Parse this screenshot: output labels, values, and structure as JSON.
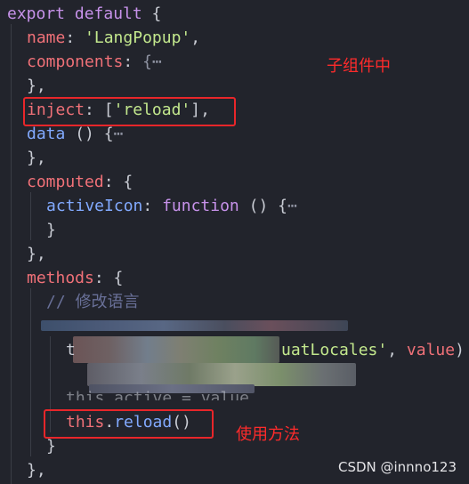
{
  "code": {
    "l1": {
      "kw": "export default",
      "brace": " {"
    },
    "l2": {
      "key": "name",
      "colon": ": ",
      "value": "'LangPopup'",
      "comma": ","
    },
    "l3": {
      "key": "components",
      "colon": ": ",
      "fold": "{⋯"
    },
    "l4": {
      "text": "},"
    },
    "l5": {
      "key": "inject",
      "colon": ": ",
      "open": "[",
      "value": "'reload'",
      "close": "],"
    },
    "l6": {
      "key": "data",
      "rest": " () {",
      "fold": "⋯"
    },
    "l7": {
      "text": "},"
    },
    "l8": {
      "key": "computed",
      "colon": ": ",
      "brace": "{"
    },
    "l9": {
      "key": "activeIcon",
      "colon": ": ",
      "kw": "function",
      "rest": " () {",
      "fold": "⋯"
    },
    "l10": {
      "text": "}"
    },
    "l11": {
      "text": "},"
    },
    "l12": {
      "key": "methods",
      "colon": ": ",
      "brace": "{"
    },
    "l13": {
      "comment": "// 修改语言"
    },
    "l15": {
      "lead": "t",
      "tail_str": "uatLocales'",
      "tail_sep": ", ",
      "tail_val": "value",
      "tail_end": ")"
    },
    "l17": {
      "partial": "this.active = value"
    },
    "l18": {
      "this": "this",
      "dot": ".",
      "method": "reload",
      "parens": "()"
    },
    "l19": {
      "text": "}"
    },
    "l20": {
      "text": "},"
    }
  },
  "annotations": {
    "child_component": "子组件中",
    "usage": "使用方法"
  },
  "watermark": "CSDN @innno123",
  "colors": {
    "background": "#22242c",
    "keyword": "#c792ea",
    "property": "#f07178",
    "string": "#c3e88d",
    "function": "#82aaff",
    "comment": "#697098",
    "highlight_box": "#e8262a",
    "annotation_text": "#ff2b2b"
  }
}
